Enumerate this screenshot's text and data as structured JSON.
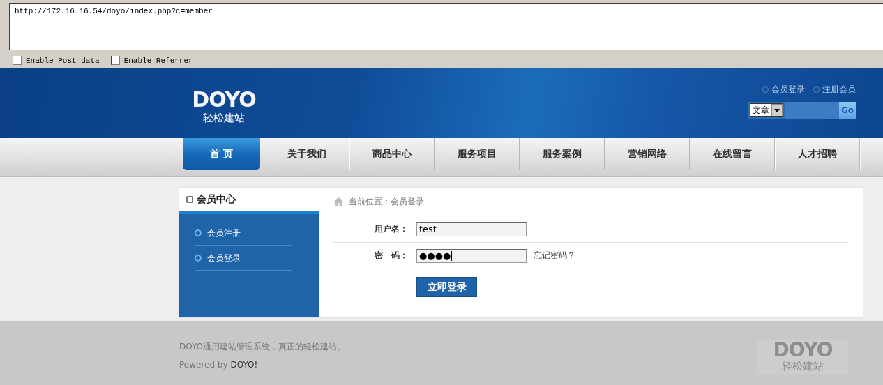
{
  "url_bar": {
    "value": "http://172.16.16.54/doyo/index.php?c=member"
  },
  "options": [
    {
      "label": "Enable Post data",
      "checked": false
    },
    {
      "label": "Enable Referrer",
      "checked": false
    }
  ],
  "header": {
    "logo": {
      "mark": "DOYO",
      "tagline": "轻松建站"
    },
    "top_links": [
      "会员登录",
      "注册会员"
    ],
    "search": {
      "category": "文章",
      "button": "Go"
    }
  },
  "nav": [
    {
      "label": "首 页",
      "selected": true
    },
    {
      "label": "关于我们",
      "selected": false
    },
    {
      "label": "商品中心",
      "selected": false
    },
    {
      "label": "服务项目",
      "selected": false
    },
    {
      "label": "服务案例",
      "selected": false
    },
    {
      "label": "营销网络",
      "selected": false
    },
    {
      "label": "在线留言",
      "selected": false
    },
    {
      "label": "人才招聘",
      "selected": false
    }
  ],
  "sidebar": {
    "title": "会员中心",
    "items": [
      "会员注册",
      "会员登录"
    ]
  },
  "breadcrumb": "当前位置：会员登录",
  "form": {
    "fields": [
      {
        "label": "用户名：",
        "value": "test"
      },
      {
        "label": "密　码：",
        "value": "●●●●",
        "focused": true
      }
    ],
    "forgot_link": "忘记密码？",
    "submit": "立即登录"
  },
  "footer": {
    "text": "DOYO通用建站管理系统，真正的轻松建站。",
    "powered_by": "Powered by",
    "powered_link": "DOYO!",
    "logo": {
      "mark": "DOYO",
      "tagline": "轻松建站"
    }
  }
}
